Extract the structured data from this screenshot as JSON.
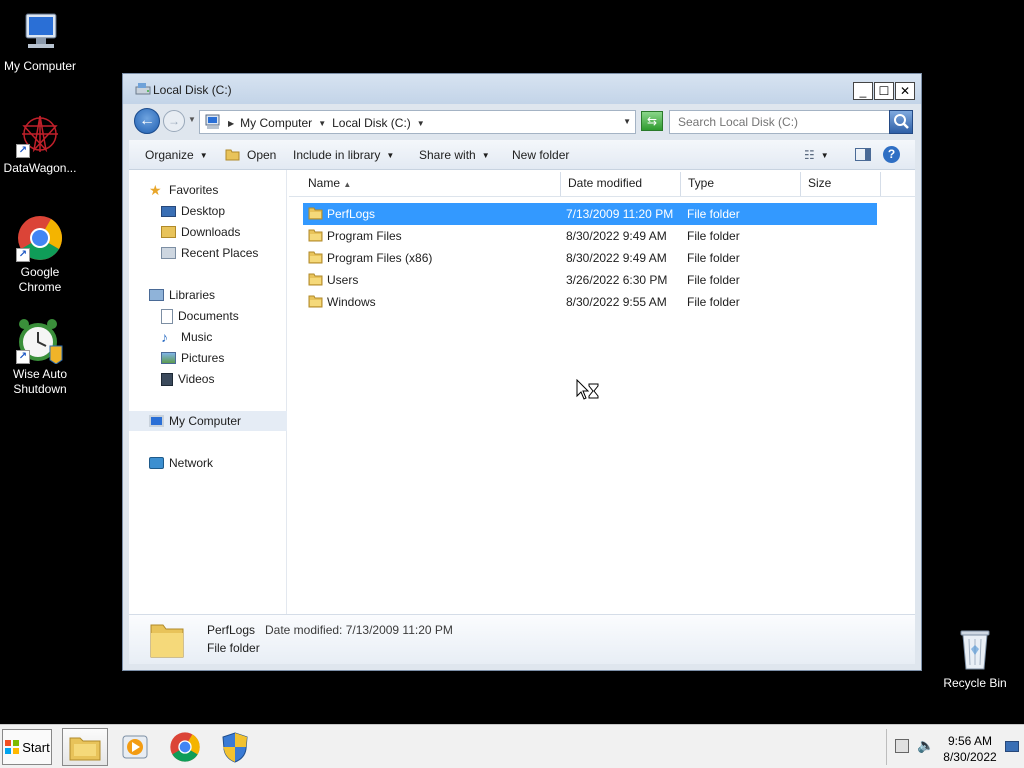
{
  "desktop": {
    "icons": [
      {
        "label": "My Computer",
        "icon": "computer-icon"
      },
      {
        "label": "DataWagon...",
        "icon": "datawagon-icon"
      },
      {
        "label": "Google Chrome",
        "icon": "chrome-icon"
      },
      {
        "label": "Wise Auto Shutdown",
        "icon": "alarm-clock-icon"
      },
      {
        "label": "Recycle Bin",
        "icon": "recycle-bin-icon"
      }
    ]
  },
  "window": {
    "title": "Local Disk (C:)",
    "address": {
      "crumbs": [
        "My Computer",
        "Local Disk (C:)"
      ]
    },
    "search": {
      "placeholder": "Search Local Disk (C:)"
    },
    "toolbar": {
      "organize": "Organize",
      "open": "Open",
      "include_in_library": "Include in library",
      "share_with": "Share with",
      "new_folder": "New folder"
    },
    "nav": {
      "favorites": "Favorites",
      "desktop": "Desktop",
      "downloads": "Downloads",
      "recent_places": "Recent Places",
      "libraries": "Libraries",
      "documents": "Documents",
      "music": "Music",
      "pictures": "Pictures",
      "videos": "Videos",
      "my_computer": "My Computer",
      "network": "Network"
    },
    "columns": {
      "name": "Name",
      "date_modified": "Date modified",
      "type": "Type",
      "size": "Size"
    },
    "files": [
      {
        "name": "PerfLogs",
        "date": "7/13/2009 11:20 PM",
        "type": "File folder",
        "size": ""
      },
      {
        "name": "Program Files",
        "date": "8/30/2022 9:49 AM",
        "type": "File folder",
        "size": ""
      },
      {
        "name": "Program Files (x86)",
        "date": "8/30/2022 9:49 AM",
        "type": "File folder",
        "size": ""
      },
      {
        "name": "Users",
        "date": "3/26/2022 6:30 PM",
        "type": "File folder",
        "size": ""
      },
      {
        "name": "Windows",
        "date": "8/30/2022 9:55 AM",
        "type": "File folder",
        "size": ""
      }
    ],
    "selected_index": 0,
    "details": {
      "name": "PerfLogs",
      "modified": "Date modified: 7/13/2009 11:20 PM",
      "type": "File folder"
    }
  },
  "taskbar": {
    "start": "Start",
    "apps": [
      "explorer-icon",
      "media-player-icon",
      "chrome-icon",
      "security-shield-icon"
    ],
    "clock": {
      "time": "9:56 AM",
      "date": "8/30/2022"
    }
  },
  "colors": {
    "selection": "#3399ff",
    "accent": "#1f5fb1"
  }
}
